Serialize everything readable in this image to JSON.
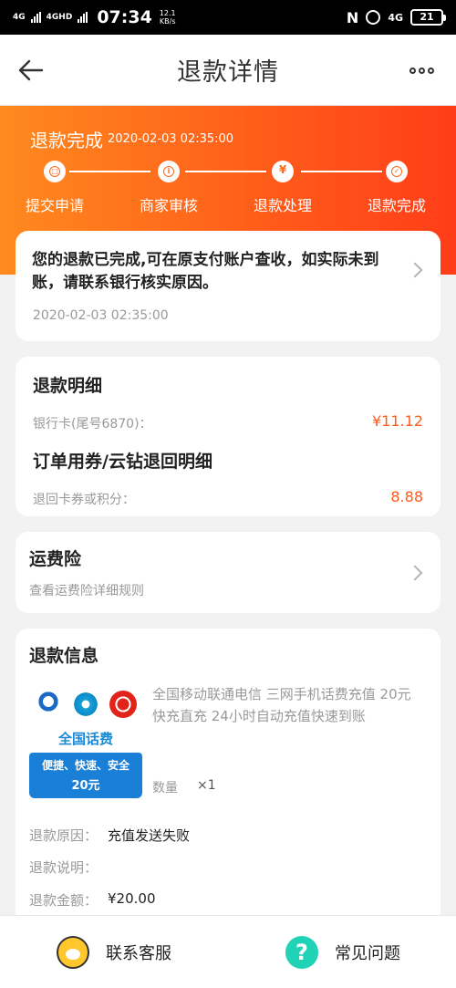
{
  "status_bar": {
    "network1": "4G",
    "network2": "4GHD",
    "time": "07:34",
    "speed_value": "12.1",
    "speed_unit": "KB/s",
    "nfc": "N",
    "network3": "4G",
    "battery": "21"
  },
  "nav": {
    "title": "退款详情"
  },
  "progress": {
    "status_text": "退款完成",
    "status_time": "2020-02-03 02:35:00",
    "steps": [
      {
        "label": "提交申请",
        "icon": "submit-icon"
      },
      {
        "label": "商家审核",
        "icon": "review-icon"
      },
      {
        "label": "退款处理",
        "icon": "yen-icon"
      },
      {
        "label": "退款完成",
        "icon": "check-icon"
      }
    ],
    "step_glyphs": [
      "□",
      "i",
      "¥",
      "✓"
    ]
  },
  "notice": {
    "text": "您的退款已完成,可在原支付账户查收，如实际未到账，请联系银行核实原因。",
    "time": "2020-02-03 02:35:00"
  },
  "refund_detail": {
    "title": "退款明细",
    "bank_label": "银行卡(尾号6870)：",
    "bank_amount": "¥11.12",
    "coupon_title": "订单用券/云钻退回明细",
    "coupon_label": "退回卡券或积分：",
    "coupon_amount": "8.88"
  },
  "insurance": {
    "title": "运费险",
    "desc": "查看运费险详细规则"
  },
  "refund_info": {
    "title": "退款信息",
    "product": {
      "image_name": "全国话费",
      "image_line1": "便捷、快速、安全",
      "image_line2": "20元",
      "title": "全国移动联通电信 三网手机话费充值 20元 快充直充 24小时自动充值快速到账",
      "qty_label": "数量",
      "qty_value": "×1"
    },
    "reason_label": "退款原因：",
    "reason_value": "充值发送失败",
    "desc_label": "退款说明：",
    "desc_value": "",
    "amount_label": "退款金额：",
    "amount_value": "¥20.00"
  },
  "bottom": {
    "service_label": "联系客服",
    "faq_label": "常见问题",
    "faq_glyph": "?"
  },
  "colors": {
    "accent": "#ff5a1a",
    "gradient_start": "#ff8a1e",
    "gradient_end": "#ff3d18",
    "faq_icon": "#20d2b6"
  }
}
